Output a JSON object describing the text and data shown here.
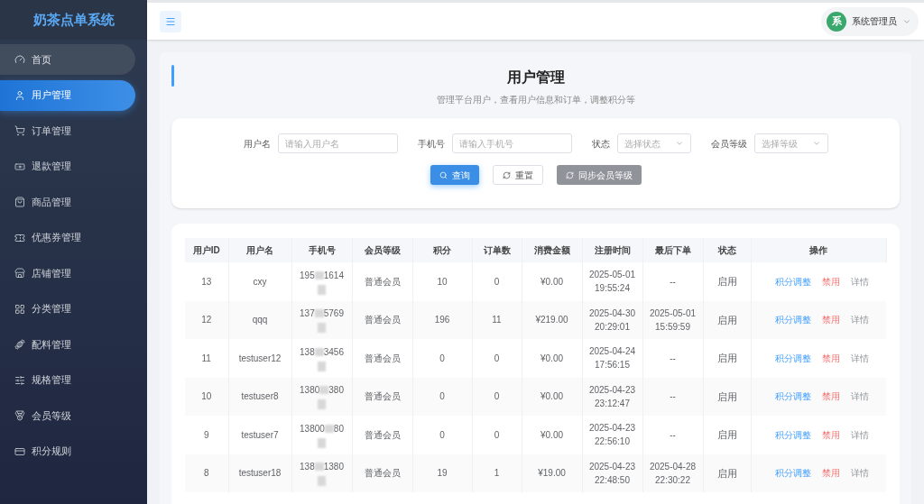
{
  "app_title": "奶茶点单系统",
  "sidebar": {
    "items": [
      {
        "label": "首页",
        "selected": false,
        "hovered": true
      },
      {
        "label": "用户管理",
        "selected": true,
        "hovered": false
      },
      {
        "label": "订单管理",
        "selected": false,
        "hovered": false
      },
      {
        "label": "退款管理",
        "selected": false,
        "hovered": false
      },
      {
        "label": "商品管理",
        "selected": false,
        "hovered": false
      },
      {
        "label": "优惠券管理",
        "selected": false,
        "hovered": false
      },
      {
        "label": "店铺管理",
        "selected": false,
        "hovered": false
      },
      {
        "label": "分类管理",
        "selected": false,
        "hovered": false
      },
      {
        "label": "配料管理",
        "selected": false,
        "hovered": false
      },
      {
        "label": "规格管理",
        "selected": false,
        "hovered": false
      },
      {
        "label": "会员等级",
        "selected": false,
        "hovered": false
      },
      {
        "label": "积分规则",
        "selected": false,
        "hovered": false
      }
    ]
  },
  "header": {
    "avatar": "系",
    "user": "系统管理员"
  },
  "page": {
    "title": "用户管理",
    "subtitle": "管理平台用户，查看用户信息和订单，调整积分等"
  },
  "filters": [
    {
      "kind": "input",
      "label": "用户名",
      "placeholder": "请输入用户名"
    },
    {
      "kind": "input",
      "label": "手机号",
      "placeholder": "请输入手机号"
    },
    {
      "kind": "select",
      "label": "状态",
      "placeholder": "选择状态"
    },
    {
      "kind": "select",
      "label": "会员等级",
      "placeholder": "选择等级"
    }
  ],
  "buttons": [
    {
      "kind": "primary",
      "label": "查询"
    },
    {
      "kind": "plain",
      "label": "重置"
    },
    {
      "kind": "gray",
      "label": "同步会员等级"
    }
  ],
  "table": {
    "columns": [
      "用户ID",
      "用户名",
      "手机号",
      "会员等级",
      "积分",
      "订单数",
      "消费金额",
      "注册时间",
      "最后下单",
      "状态",
      "操作"
    ],
    "rows": [
      {
        "id": "13",
        "name": "cxy",
        "phone_head": "195",
        "phone_tail": "1614",
        "level": "普通会员",
        "points": "10",
        "orders": "0",
        "amount": "¥0.00",
        "registered": [
          "2025-05-01",
          "19:55:24"
        ],
        "last_order": [
          "--"
        ],
        "status": "启用",
        "actions": [
          "积分调整",
          "禁用",
          "详情"
        ]
      },
      {
        "id": "12",
        "name": "qqq",
        "phone_head": "137",
        "phone_tail": "5769",
        "level": "普通会员",
        "points": "196",
        "orders": "11",
        "amount": "¥219.00",
        "registered": [
          "2025-04-30",
          "20:29:01"
        ],
        "last_order": [
          "2025-05-01",
          "15:59:59"
        ],
        "status": "启用",
        "actions": [
          "积分调整",
          "禁用",
          "详情"
        ]
      },
      {
        "id": "11",
        "name": "testuser12",
        "phone_head": "138",
        "phone_tail": "3456",
        "level": "普通会员",
        "points": "0",
        "orders": "0",
        "amount": "¥0.00",
        "registered": [
          "2025-04-24",
          "17:56:15"
        ],
        "last_order": [
          "--"
        ],
        "status": "启用",
        "actions": [
          "积分调整",
          "禁用",
          "详情"
        ]
      },
      {
        "id": "10",
        "name": "testuser8",
        "phone_head": "1380",
        "phone_tail": "380",
        "level": "普通会员",
        "points": "0",
        "orders": "0",
        "amount": "¥0.00",
        "registered": [
          "2025-04-23",
          "23:12:47"
        ],
        "last_order": [
          "--"
        ],
        "status": "启用",
        "actions": [
          "积分调整",
          "禁用",
          "详情"
        ]
      },
      {
        "id": "9",
        "name": "testuser7",
        "phone_head": "13800",
        "phone_tail": "80",
        "level": "普通会员",
        "points": "0",
        "orders": "0",
        "amount": "¥0.00",
        "registered": [
          "2025-04-23",
          "22:56:10"
        ],
        "last_order": [
          "--"
        ],
        "status": "启用",
        "actions": [
          "积分调整",
          "禁用",
          "详情"
        ]
      },
      {
        "id": "8",
        "name": "testuser18",
        "phone_head": "138",
        "phone_tail": "1380",
        "level": "普通会员",
        "points": "19",
        "orders": "1",
        "amount": "¥19.00",
        "registered": [
          "2025-04-23",
          "22:48:50"
        ],
        "last_order": [
          "2025-04-28",
          "22:30:22"
        ],
        "status": "启用",
        "actions": [
          "积分调整",
          "禁用",
          "详情"
        ]
      }
    ]
  }
}
